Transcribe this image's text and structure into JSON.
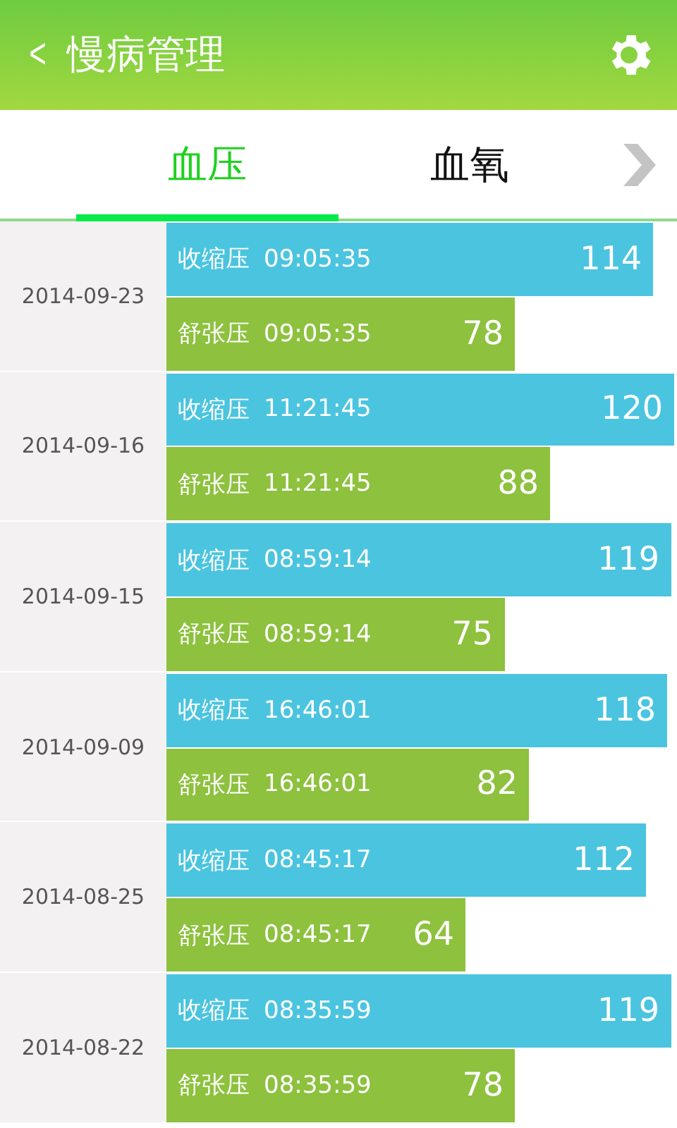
{
  "header": {
    "back": "<",
    "title": "慢病管理"
  },
  "tabs": [
    {
      "label": "血压",
      "selected": true
    },
    {
      "label": "血氧",
      "selected": false
    }
  ],
  "records": [
    {
      "date": "2014-09-23",
      "readings": [
        {
          "kind": "systolic",
          "label": "收缩压",
          "time": "09:05:35",
          "value": "114"
        },
        {
          "kind": "diastolic",
          "label": "舒张压",
          "time": "09:05:35",
          "value": "78"
        }
      ]
    },
    {
      "date": "2014-09-16",
      "readings": [
        {
          "kind": "systolic",
          "label": "收缩压",
          "time": "11:21:45",
          "value": "120"
        },
        {
          "kind": "diastolic",
          "label": "舒张压",
          "time": "11:21:45",
          "value": "88"
        }
      ]
    },
    {
      "date": "2014-09-15",
      "readings": [
        {
          "kind": "systolic",
          "label": "收缩压",
          "time": "08:59:14",
          "value": "119"
        },
        {
          "kind": "diastolic",
          "label": "舒张压",
          "time": "08:59:14",
          "value": "75"
        }
      ]
    },
    {
      "date": "2014-09-09",
      "readings": [
        {
          "kind": "systolic",
          "label": "收缩压",
          "time": "16:46:01",
          "value": "118"
        },
        {
          "kind": "diastolic",
          "label": "舒张压",
          "time": "16:46:01",
          "value": "82"
        }
      ]
    },
    {
      "date": "2014-08-25",
      "readings": [
        {
          "kind": "systolic",
          "label": "收缩压",
          "time": "08:45:17",
          "value": "112"
        },
        {
          "kind": "diastolic",
          "label": "舒张压",
          "time": "08:45:17",
          "value": "64"
        }
      ]
    },
    {
      "date": "2014-08-22",
      "readings": [
        {
          "kind": "systolic",
          "label": "收缩压",
          "time": "08:35:59",
          "value": "119"
        },
        {
          "kind": "diastolic",
          "label": "舒张压",
          "time": "08:35:59",
          "value": "78"
        }
      ]
    }
  ]
}
